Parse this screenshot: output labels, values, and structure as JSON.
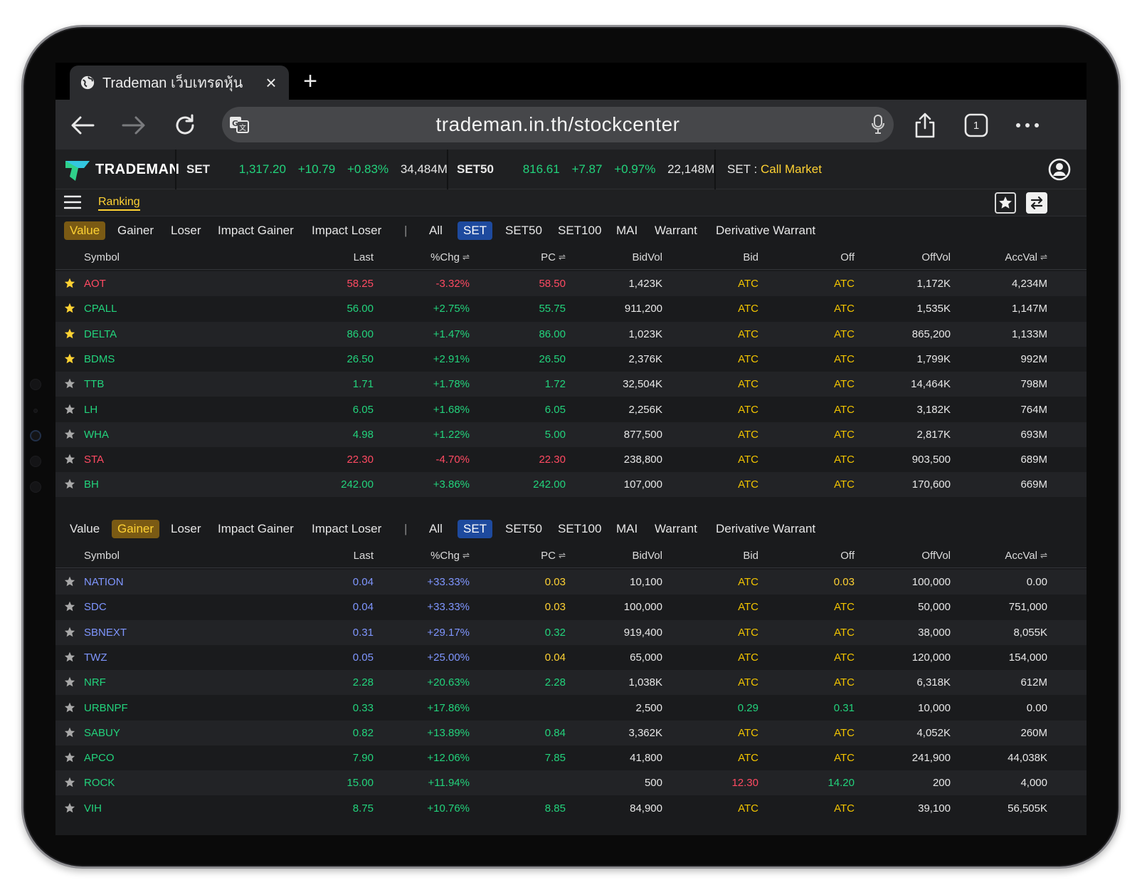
{
  "browser": {
    "tab_title": "Trademan เว็บเทรดหุ้น",
    "url": "trademan.in.th/stockcenter",
    "tab_count": "1"
  },
  "header": {
    "brand": "TRADEMAN",
    "set": {
      "label": "SET",
      "value": "1,317.20",
      "change": "+10.79",
      "pct": "+0.83%",
      "volume": "34,484M"
    },
    "set50": {
      "label": "SET50",
      "value": "816.61",
      "change": "+7.87",
      "pct": "+0.97%",
      "volume": "22,148M"
    },
    "market": {
      "label": "SET",
      "colon": ":",
      "status": "Call Market"
    }
  },
  "menu": {
    "ranking": "Ranking"
  },
  "filters": {
    "ranking_types": [
      "Value",
      "Gainer",
      "Loser",
      "Impact Gainer",
      "Impact Loser"
    ],
    "separator": "|",
    "markets": [
      "All",
      "SET",
      "SET50",
      "SET100",
      "MAI",
      "Warrant",
      "Derivative Warrant"
    ]
  },
  "columns": [
    "Symbol",
    "Last",
    "%Chg",
    "PC",
    "BidVol",
    "Bid",
    "Off",
    "OffVol",
    "AccVal"
  ],
  "sort_glyph": "⇌",
  "colors": {
    "up": "#22d37c",
    "down": "#ff4a62",
    "ceiling": "#7f96ff",
    "atc": "#f2c400",
    "accent": "#ffd233"
  },
  "value_table": [
    {
      "fav": true,
      "symbol": "AOT",
      "last": "58.25",
      "chg": "-3.32%",
      "pc": "58.50",
      "bidvol": "1,423K",
      "bid": "ATC",
      "off": "ATC",
      "offvol": "1,172K",
      "accval": "4,234M",
      "c": "red"
    },
    {
      "fav": true,
      "symbol": "CPALL",
      "last": "56.00",
      "chg": "+2.75%",
      "pc": "55.75",
      "bidvol": "911,200",
      "bid": "ATC",
      "off": "ATC",
      "offvol": "1,535K",
      "accval": "1,147M",
      "c": "green"
    },
    {
      "fav": true,
      "symbol": "DELTA",
      "last": "86.00",
      "chg": "+1.47%",
      "pc": "86.00",
      "bidvol": "1,023K",
      "bid": "ATC",
      "off": "ATC",
      "offvol": "865,200",
      "accval": "1,133M",
      "c": "green"
    },
    {
      "fav": true,
      "symbol": "BDMS",
      "last": "26.50",
      "chg": "+2.91%",
      "pc": "26.50",
      "bidvol": "2,376K",
      "bid": "ATC",
      "off": "ATC",
      "offvol": "1,799K",
      "accval": "992M",
      "c": "green"
    },
    {
      "fav": false,
      "symbol": "TTB",
      "last": "1.71",
      "chg": "+1.78%",
      "pc": "1.72",
      "bidvol": "32,504K",
      "bid": "ATC",
      "off": "ATC",
      "offvol": "14,464K",
      "accval": "798M",
      "c": "green"
    },
    {
      "fav": false,
      "symbol": "LH",
      "last": "6.05",
      "chg": "+1.68%",
      "pc": "6.05",
      "bidvol": "2,256K",
      "bid": "ATC",
      "off": "ATC",
      "offvol": "3,182K",
      "accval": "764M",
      "c": "green"
    },
    {
      "fav": false,
      "symbol": "WHA",
      "last": "4.98",
      "chg": "+1.22%",
      "pc": "5.00",
      "bidvol": "877,500",
      "bid": "ATC",
      "off": "ATC",
      "offvol": "2,817K",
      "accval": "693M",
      "c": "green"
    },
    {
      "fav": false,
      "symbol": "STA",
      "last": "22.30",
      "chg": "-4.70%",
      "pc": "22.30",
      "bidvol": "238,800",
      "bid": "ATC",
      "off": "ATC",
      "offvol": "903,500",
      "accval": "689M",
      "c": "red"
    },
    {
      "fav": false,
      "symbol": "BH",
      "last": "242.00",
      "chg": "+3.86%",
      "pc": "242.00",
      "bidvol": "107,000",
      "bid": "ATC",
      "off": "ATC",
      "offvol": "170,600",
      "accval": "669M",
      "c": "green"
    }
  ],
  "gainer_table": [
    {
      "symbol": "NATION",
      "last": "0.04",
      "chg": "+33.33%",
      "pc": "0.03",
      "bidvol": "10,100",
      "bid": "ATC",
      "off": "0.03",
      "offvol": "100,000",
      "accval": "0.00",
      "c": "blue",
      "pcc": "yellow",
      "offc": "yellow",
      "bidc": "gold"
    },
    {
      "symbol": "SDC",
      "last": "0.04",
      "chg": "+33.33%",
      "pc": "0.03",
      "bidvol": "100,000",
      "bid": "ATC",
      "off": "ATC",
      "offvol": "50,000",
      "accval": "751,000",
      "c": "blue",
      "pcc": "yellow",
      "offc": "gold",
      "bidc": "gold"
    },
    {
      "symbol": "SBNEXT",
      "last": "0.31",
      "chg": "+29.17%",
      "pc": "0.32",
      "bidvol": "919,400",
      "bid": "ATC",
      "off": "ATC",
      "offvol": "38,000",
      "accval": "8,055K",
      "c": "blue",
      "pcc": "green",
      "offc": "gold",
      "bidc": "gold"
    },
    {
      "symbol": "TWZ",
      "last": "0.05",
      "chg": "+25.00%",
      "pc": "0.04",
      "bidvol": "65,000",
      "bid": "ATC",
      "off": "ATC",
      "offvol": "120,000",
      "accval": "154,000",
      "c": "blue",
      "pcc": "yellow",
      "offc": "gold",
      "bidc": "gold"
    },
    {
      "symbol": "NRF",
      "last": "2.28",
      "chg": "+20.63%",
      "pc": "2.28",
      "bidvol": "1,038K",
      "bid": "ATC",
      "off": "ATC",
      "offvol": "6,318K",
      "accval": "612M",
      "c": "green",
      "pcc": "green",
      "offc": "gold",
      "bidc": "gold"
    },
    {
      "symbol": "URBNPF",
      "last": "0.33",
      "chg": "+17.86%",
      "pc": "",
      "bidvol": "2,500",
      "bid": "0.29",
      "off": "0.31",
      "offvol": "10,000",
      "accval": "0.00",
      "c": "green",
      "pcc": "green",
      "offc": "green",
      "bidc": "green"
    },
    {
      "symbol": "SABUY",
      "last": "0.82",
      "chg": "+13.89%",
      "pc": "0.84",
      "bidvol": "3,362K",
      "bid": "ATC",
      "off": "ATC",
      "offvol": "4,052K",
      "accval": "260M",
      "c": "green",
      "pcc": "green",
      "offc": "gold",
      "bidc": "gold"
    },
    {
      "symbol": "APCO",
      "last": "7.90",
      "chg": "+12.06%",
      "pc": "7.85",
      "bidvol": "41,800",
      "bid": "ATC",
      "off": "ATC",
      "offvol": "241,900",
      "accval": "44,038K",
      "c": "green",
      "pcc": "green",
      "offc": "gold",
      "bidc": "gold"
    },
    {
      "symbol": "ROCK",
      "last": "15.00",
      "chg": "+11.94%",
      "pc": "",
      "bidvol": "500",
      "bid": "12.30",
      "off": "14.20",
      "offvol": "200",
      "accval": "4,000",
      "c": "green",
      "pcc": "green",
      "offc": "green",
      "bidc": "red"
    },
    {
      "symbol": "VIH",
      "last": "8.75",
      "chg": "+10.76%",
      "pc": "8.85",
      "bidvol": "84,900",
      "bid": "ATC",
      "off": "ATC",
      "offvol": "39,100",
      "accval": "56,505K",
      "c": "green",
      "pcc": "green",
      "offc": "gold",
      "bidc": "gold"
    }
  ]
}
